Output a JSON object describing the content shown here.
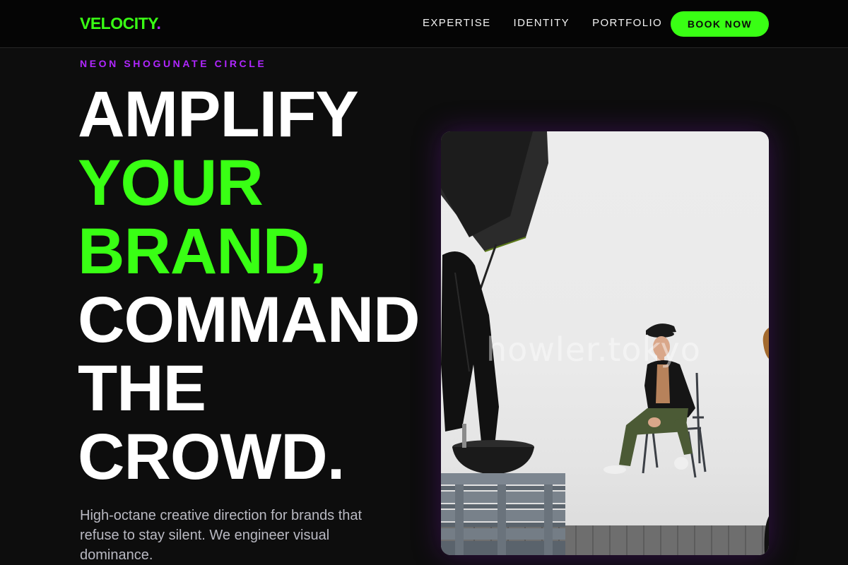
{
  "navbar": {
    "logo": "VELOCITY",
    "logo_dot": ".",
    "links": [
      {
        "label": "EXPERTISE"
      },
      {
        "label": "IDENTITY"
      },
      {
        "label": "PORTFOLIO"
      }
    ],
    "cta": "BOOK NOW"
  },
  "hero": {
    "eyebrow": "NEON SHOGUNATE CIRCLE",
    "headline": {
      "line1": "AMPLIFY",
      "line2": "YOUR",
      "line3": "BRAND,",
      "line4": "COMMAND",
      "line5": "THE",
      "line6": "CROWD."
    },
    "subtext": "High-octane creative direction for brands that refuse to stay silent. We engineer visual dominance.",
    "image": {
      "watermark": "howler.tokyo"
    }
  },
  "colors": {
    "accent_green": "#39ff14",
    "accent_purple": "#b026ff",
    "background": "#0d0d0d"
  }
}
